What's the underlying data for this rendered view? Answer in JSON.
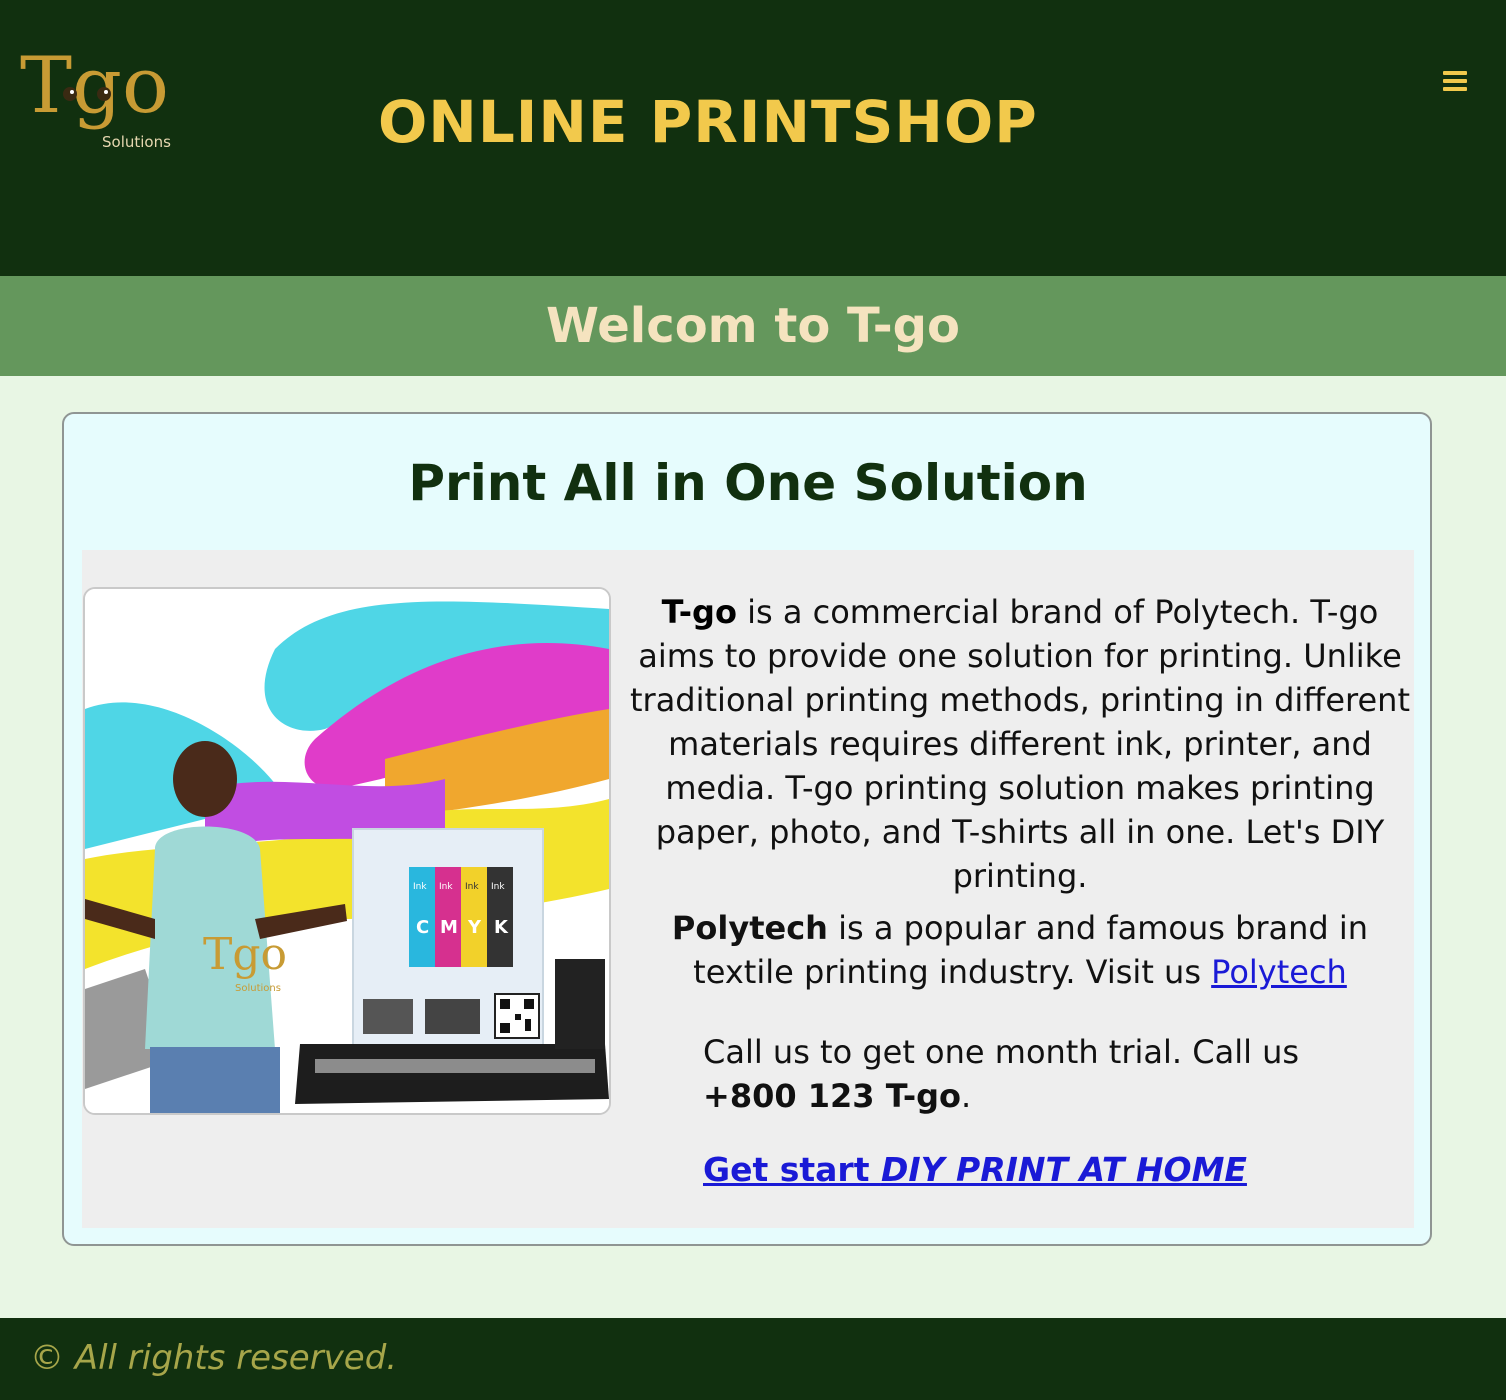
{
  "header": {
    "logo_text": "Tgo",
    "logo_subtext": "Solutions",
    "title": "ONLINE PRINTSHOP",
    "menu_icon": "hamburger-menu-icon"
  },
  "welcome": {
    "heading": "Welcom to T-go"
  },
  "main": {
    "card_title": "Print All in One Solution",
    "hero_image": {
      "ink_cartridge_letters": [
        "C",
        "M",
        "Y",
        "K"
      ],
      "ink_label": "Ink",
      "shirt_logo_text": "Tgo",
      "shirt_logo_subtext": "Solutions"
    },
    "about": {
      "brand": "T-go",
      "text": " is a commercial brand of Polytech. T-go aims to provide one solution for printing. Unlike traditional printing methods, printing in different materials requires different ink, printer, and media. T-go printing solution makes printing paper, photo, and T-shirts all in one. Let's DIY printing."
    },
    "polytech": {
      "brand": "Polytech",
      "text": " is a popular and famous brand in textile printing industry. Visit us ",
      "link_label": "Polytech"
    },
    "call": {
      "text": "Call us to get one month trial. Call us ",
      "phone": "+800 123 T-go",
      "suffix": "."
    },
    "cta": {
      "prefix": "Get start ",
      "emphasis": "DIY PRINT AT HOME"
    }
  },
  "footer": {
    "copyright": "© All rights reserved."
  },
  "colors": {
    "header_bg": "#11300f",
    "title_yellow": "#f2c94c",
    "welcome_bg": "#64975c",
    "welcome_text": "#f5e3bf",
    "page_bg": "#e8f6e4",
    "card_bg": "#e6fcfd",
    "content_bg": "#eeeeee",
    "link_blue": "#1a1ad6",
    "footer_text": "#a7a64a"
  }
}
